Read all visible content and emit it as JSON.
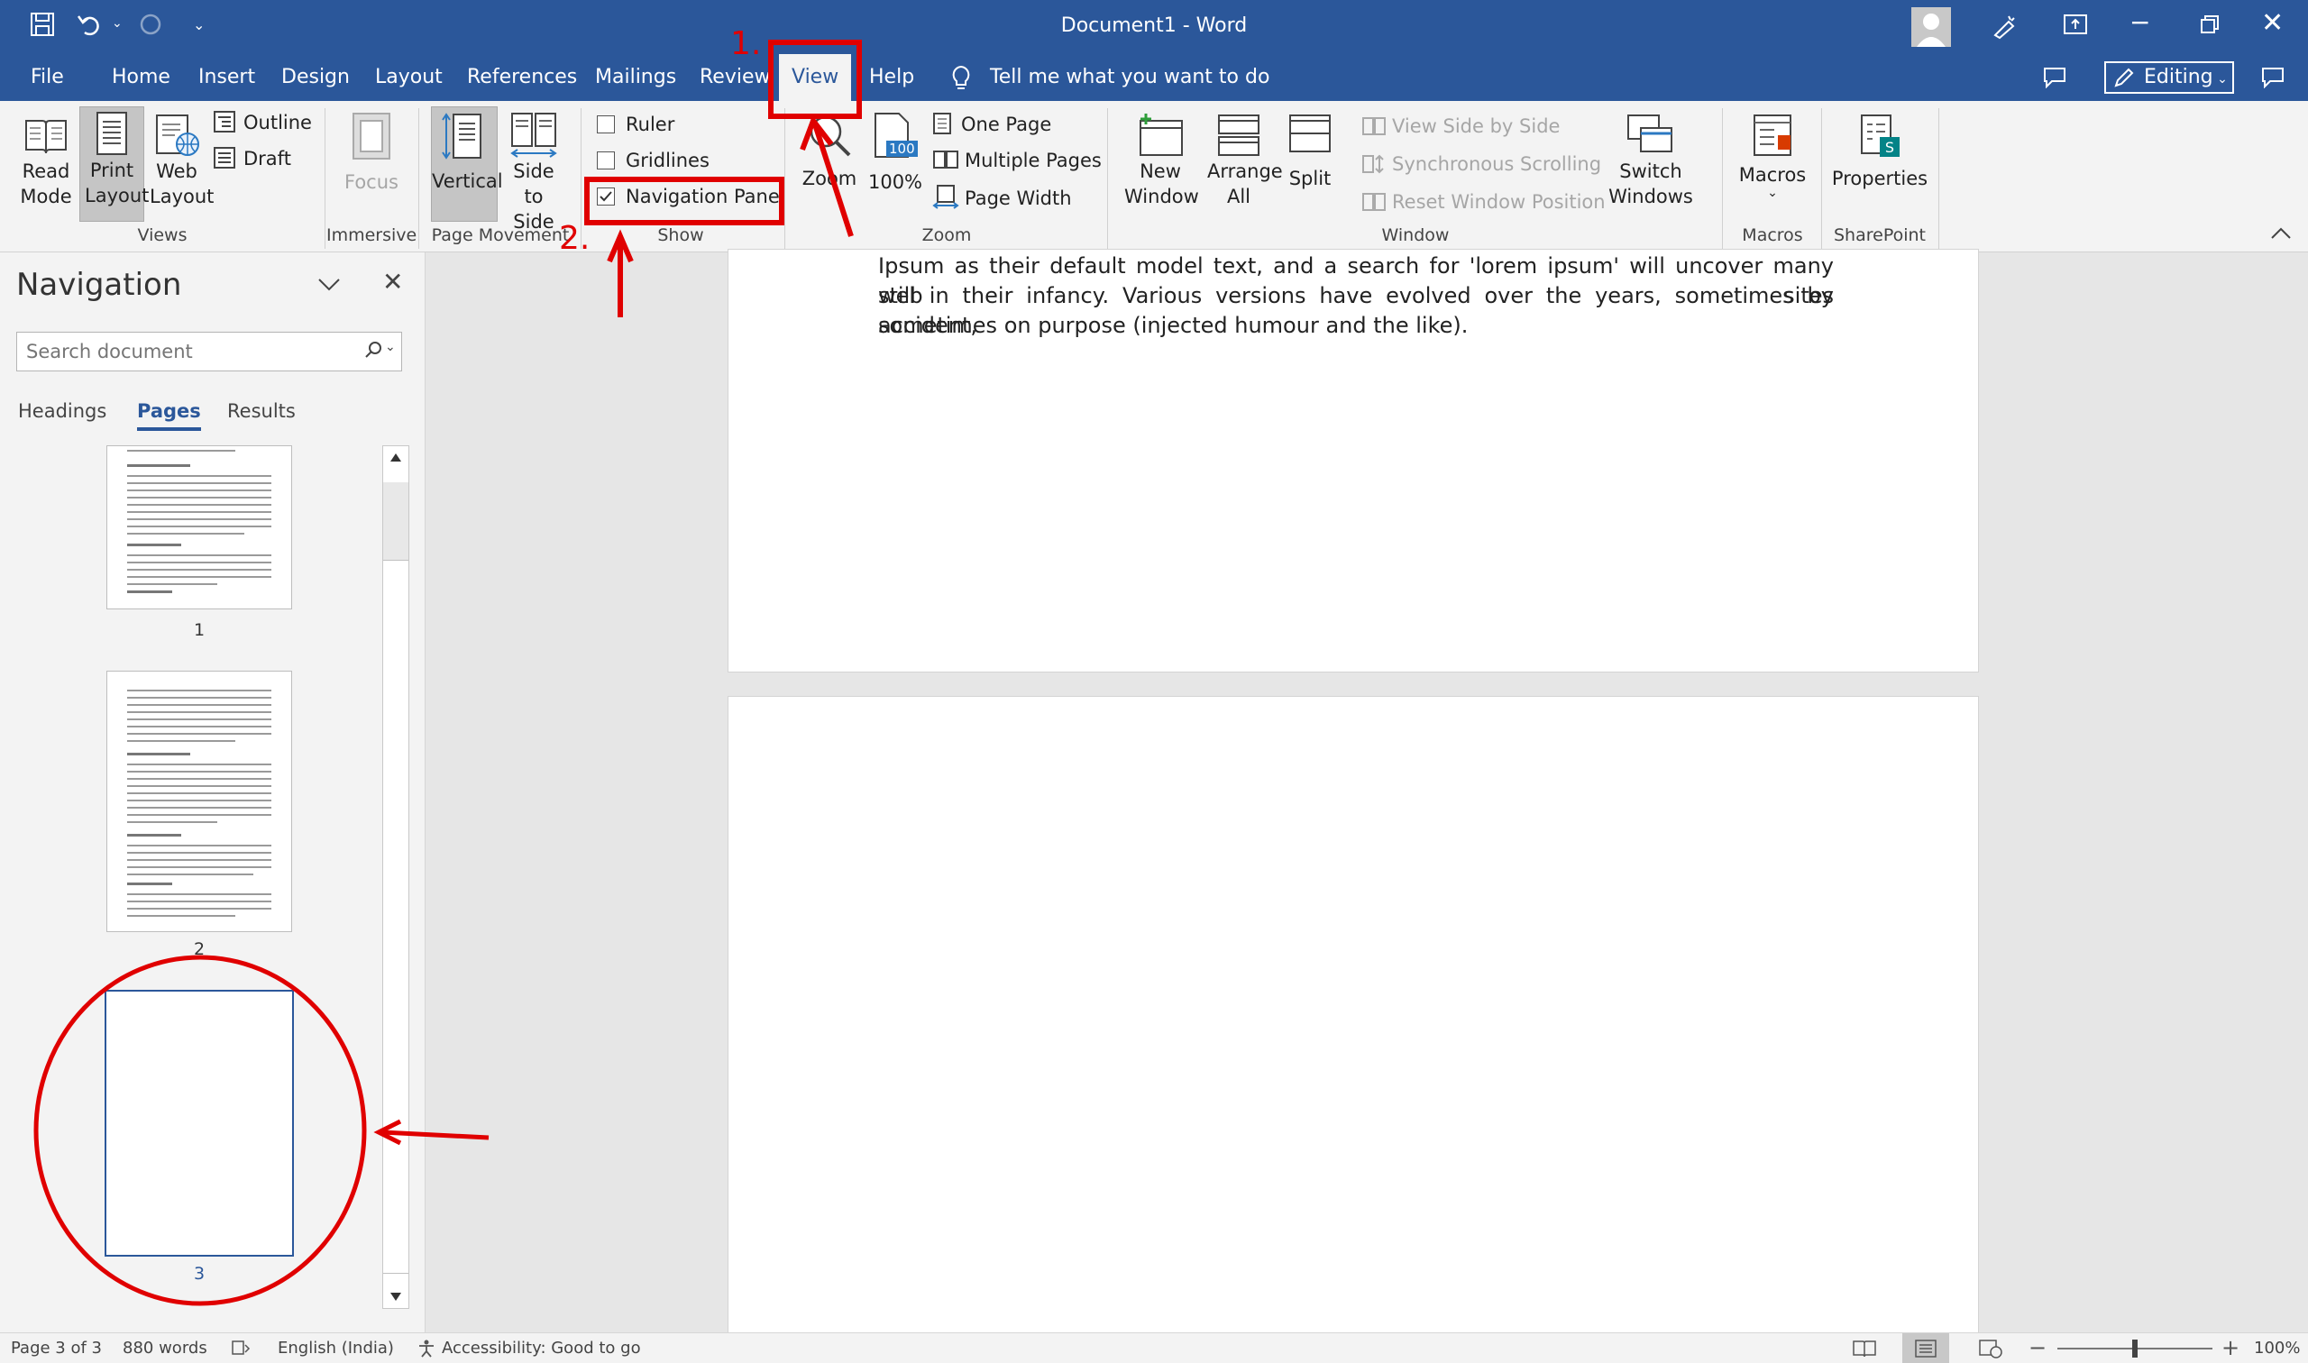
{
  "app": {
    "title": "Document1  -  Word",
    "editing": "Editing"
  },
  "tabs": [
    {
      "label": "File"
    },
    {
      "label": "Home"
    },
    {
      "label": "Insert"
    },
    {
      "label": "Design"
    },
    {
      "label": "Layout"
    },
    {
      "label": "References"
    },
    {
      "label": "Mailings"
    },
    {
      "label": "Review"
    },
    {
      "label": "View",
      "active": true
    },
    {
      "label": "Help"
    }
  ],
  "tell_me": "Tell me what you want to do",
  "ribbon": {
    "views": {
      "read_mode": "Read Mode",
      "print_layout": "Print Layout",
      "web_layout": "Web Layout",
      "outline": "Outline",
      "draft": "Draft",
      "group": "Views"
    },
    "immersive": {
      "focus": "Focus",
      "group": "Immersive"
    },
    "page_movement": {
      "vertical": "Vertical",
      "side_to_side": "Side to Side",
      "group": "Page Movement"
    },
    "show": {
      "ruler": "Ruler",
      "gridlines": "Gridlines",
      "navigation_pane": "Navigation Pane",
      "ruler_checked": false,
      "gridlines_checked": false,
      "navigation_pane_checked": true,
      "group": "Show"
    },
    "zoom": {
      "zoom": "Zoom",
      "hundred": "100%",
      "icon_text": "100",
      "one_page": "One Page",
      "multiple_pages": "Multiple Pages",
      "page_width": "Page Width",
      "group": "Zoom"
    },
    "window": {
      "new_window": "New Window",
      "arrange_all": "Arrange All",
      "split": "Split",
      "view_side_by_side": "View Side by Side",
      "synchronous_scrolling": "Synchronous Scrolling",
      "reset_window_position": "Reset Window Position",
      "switch_windows": "Switch Windows",
      "group": "Window"
    },
    "macros": {
      "macros": "Macros",
      "group": "Macros"
    },
    "sharepoint": {
      "properties": "Properties",
      "group": "SharePoint"
    }
  },
  "nav": {
    "title": "Navigation",
    "search_placeholder": "Search document",
    "tabs": {
      "headings": "Headings",
      "pages": "Pages",
      "results": "Results",
      "active": "Pages"
    },
    "thumbs": [
      {
        "num": "1"
      },
      {
        "num": "2"
      },
      {
        "num": "3",
        "selected": true
      }
    ]
  },
  "document": {
    "lines": [
      "Ipsum as their default model text, and a search for 'lorem ipsum' will uncover many web sites",
      "still in their infancy. Various versions have evolved over the years, sometimes by accident,",
      "sometimes on purpose (injected humour and the like)."
    ]
  },
  "status": {
    "page": "Page 3 of 3",
    "words": "880 words",
    "language": "English (India)",
    "accessibility": "Accessibility: Good to go",
    "zoom": "100%",
    "zoom_fraction": 0.5
  },
  "annotations": {
    "step1": "1.",
    "step2": "2."
  },
  "colors": {
    "brand": "#2b579a",
    "annotation": "#e00000",
    "selection": "#2b579a"
  }
}
